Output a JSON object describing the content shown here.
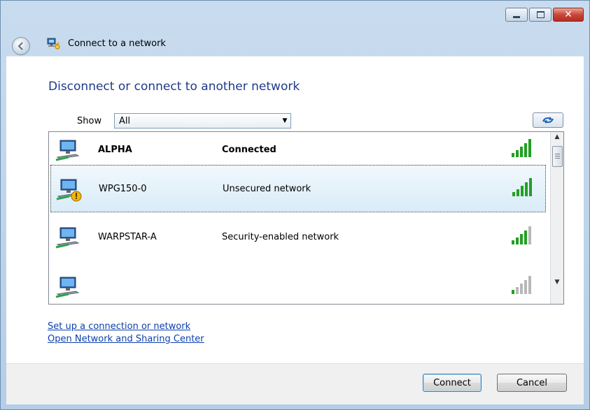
{
  "window": {
    "title": "Connect to a network",
    "controls": {
      "minimize": "minimize",
      "maximize": "maximize",
      "close": "close"
    }
  },
  "main": {
    "heading": "Disconnect or connect to another network",
    "show_label": "Show",
    "show_value": "All"
  },
  "networks": [
    {
      "name": "ALPHA",
      "status": "Connected",
      "bold": true,
      "signal_bars": 5,
      "secured": true,
      "selected": false
    },
    {
      "name": "WPG150-0",
      "status": "Unsecured network",
      "bold": false,
      "signal_bars": 5,
      "secured": false,
      "selected": true
    },
    {
      "name": "WARPSTAR-A",
      "status": "Security-enabled network",
      "bold": false,
      "signal_bars": 4,
      "secured": true,
      "selected": false
    },
    {
      "name": "",
      "status": "",
      "bold": false,
      "signal_bars": 1,
      "secured": true,
      "selected": false
    }
  ],
  "links": {
    "setup": "Set up a connection or network",
    "sharing_center": "Open Network and Sharing Center"
  },
  "footer": {
    "connect_label": "Connect",
    "cancel_label": "Cancel"
  },
  "colors": {
    "heading": "#1e3a8a",
    "link": "#0c3fae",
    "signal_on": "#22a022",
    "signal_off": "#b8b8b8",
    "frame": "#b5cde6"
  },
  "icons": {
    "back": "back-arrow-icon",
    "title": "network-connect-icon",
    "refresh": "refresh-icon",
    "network": "network-computer-icon",
    "warning": "shield-warning-icon",
    "signal": "signal-strength-icon"
  }
}
